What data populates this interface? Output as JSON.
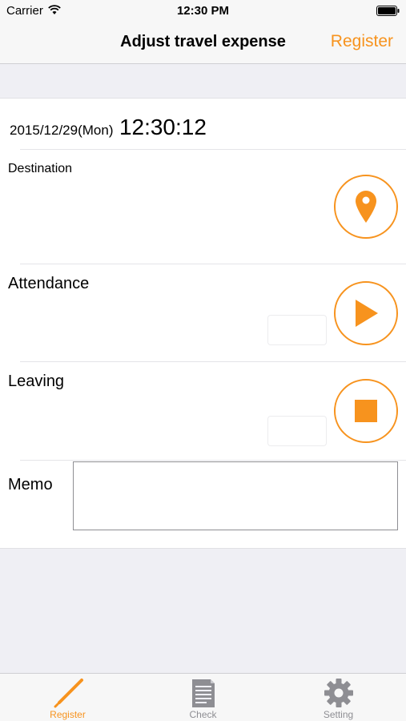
{
  "status_bar": {
    "carrier": "Carrier",
    "time": "12:30 PM"
  },
  "nav": {
    "title": "Adjust travel expense",
    "right_button": "Register"
  },
  "main": {
    "date": "2015/12/29(Mon)",
    "clock": "12:30:12",
    "destination_label": "Destination",
    "attendance_label": "Attendance",
    "attendance_value": "",
    "leaving_label": "Leaving",
    "leaving_value": "",
    "memo_label": "Memo",
    "memo_value": ""
  },
  "tabs": [
    {
      "label": "Register",
      "icon": "pencil-icon",
      "active": true
    },
    {
      "label": "Check",
      "icon": "document-icon",
      "active": false
    },
    {
      "label": "Setting",
      "icon": "gear-icon",
      "active": false
    }
  ],
  "colors": {
    "accent": "#f7931e",
    "inactive": "#8e8e93",
    "background": "#efeff4"
  }
}
